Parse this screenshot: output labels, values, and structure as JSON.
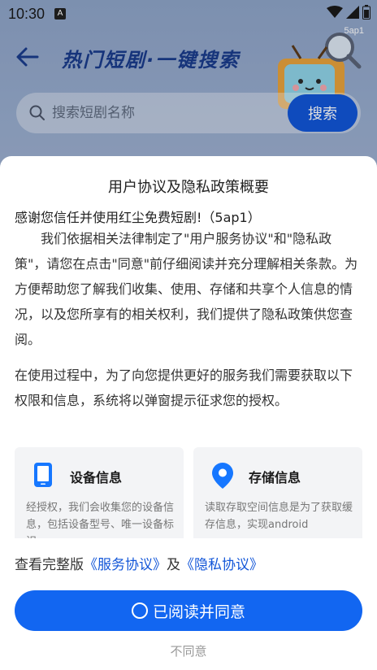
{
  "status_bar": {
    "time": "10:30",
    "notification_glyph": "A",
    "badge": "5ap1"
  },
  "header": {
    "title": "热门短剧·一键搜索"
  },
  "search": {
    "placeholder": "搜索短剧名称",
    "button_label": "搜索"
  },
  "dialog": {
    "title": "用户协议及隐私政策概要",
    "greeting": "感谢您信任并使用红尘免费短剧!（5ap1）",
    "paragraph1": "我们依据相关法律制定了\"用户服务协议\"和\"隐私政策\"，请您在点击\"同意\"前仔细阅读并充分理解相关条款。为方便帮助您了解我们收集、使用、存储和共享个人信息的情况，以及您所享有的相关权利，我们提供了隐私政策供您查阅。",
    "paragraph2": "在使用过程中，为了向您提供更好的服务我们需要获取以下权限和信息，系统将以弹窗提示征求您的授权。",
    "cards": [
      {
        "title": "设备信息",
        "icon": "phone-icon",
        "description": "经授权，我们会收集您的设备信息，包括设备型号、唯一设备标识"
      },
      {
        "title": "存储信息",
        "icon": "location-pin-icon",
        "description": "读取存取空间信息是为了获取缓存信息，实现android"
      }
    ],
    "links": {
      "prefix": "查看完整版",
      "service_agreement": "《服务协议》",
      "conjunction": "及",
      "privacy_agreement": "《隐私协议》"
    },
    "agree_label": "已阅读并同意",
    "disagree_label": "不同意"
  },
  "colors": {
    "primary": "#1266f1",
    "link": "#1256d8",
    "title_blue": "#1a3c8c"
  }
}
